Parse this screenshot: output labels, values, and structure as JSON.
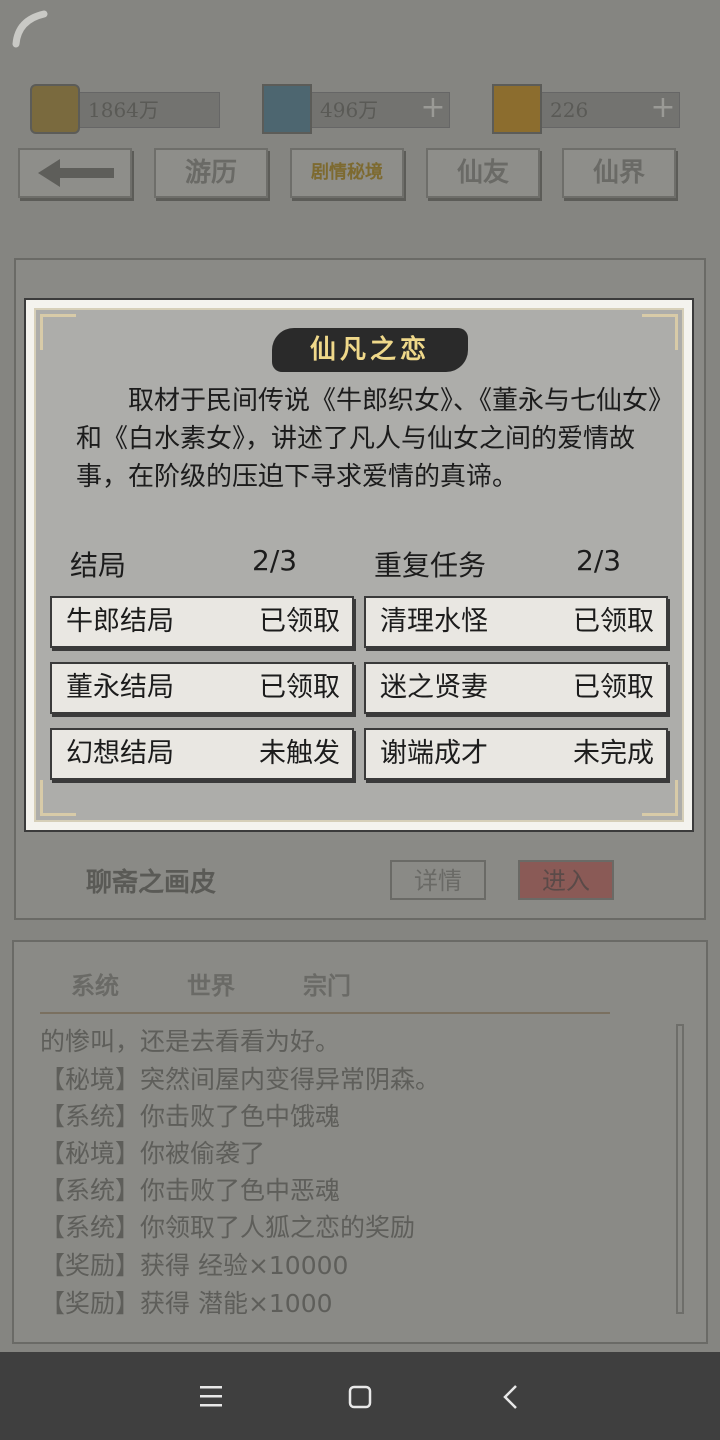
{
  "resources": [
    {
      "icon": "coin-icon",
      "value": "1864万"
    },
    {
      "icon": "sword-icon",
      "value": "496万"
    },
    {
      "icon": "scroll-icon",
      "value": "226"
    }
  ],
  "nav": {
    "back_icon": "arrow-left-icon",
    "tabs": [
      "游历",
      "剧情秘境",
      "仙友",
      "仙界"
    ]
  },
  "background_panel": {
    "quest_name": "聊斋之画皮",
    "details_label": "详情",
    "enter_label": "进入"
  },
  "chat": {
    "tabs": [
      "系统",
      "世界",
      "宗门"
    ],
    "lines": [
      "的惨叫，还是去看看为好。",
      "【秘境】突然间屋内变得异常阴森。",
      "【系统】你击败了色中饿魂",
      "【秘境】你被偷袭了",
      "【系统】你击败了色中恶魂",
      "【系统】你领取了人狐之恋的奖励",
      "【奖励】获得 经验×10000",
      "【奖励】获得 潜能×1000"
    ]
  },
  "modal": {
    "title": "仙凡之恋",
    "description": "取材于民间传说《牛郎织女》、《董永与七仙女》和《白水素女》，讲述了凡人与仙女之间的爱情故事，在阶级的压迫下寻求爱情的真谛。",
    "endings": {
      "label": "结局",
      "progress": "2/3",
      "items": [
        {
          "name": "牛郎结局",
          "status": "已领取"
        },
        {
          "name": "董永结局",
          "status": "已领取"
        },
        {
          "name": "幻想结局",
          "status": "未触发"
        }
      ]
    },
    "repeat_tasks": {
      "label": "重复任务",
      "progress": "2/3",
      "items": [
        {
          "name": "清理水怪",
          "status": "已领取"
        },
        {
          "name": "迷之贤妻",
          "status": "已领取"
        },
        {
          "name": "谢端成才",
          "status": "未完成"
        }
      ]
    }
  },
  "system_nav": {
    "icons": [
      "menu-icon",
      "home-icon",
      "back-icon"
    ]
  }
}
